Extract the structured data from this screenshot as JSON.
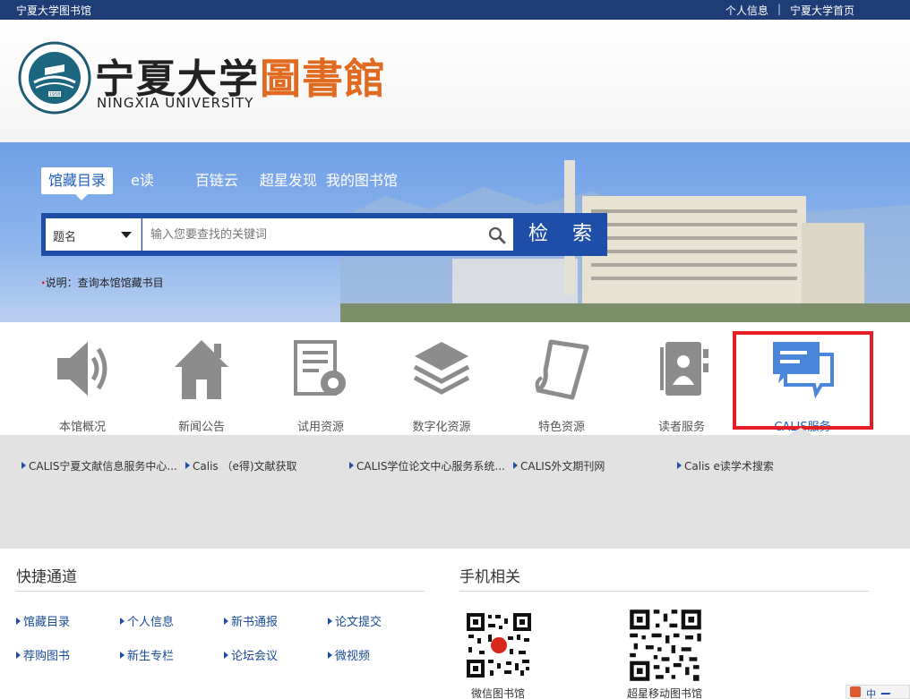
{
  "topbar": {
    "site_name": "宁夏大学图书馆",
    "links": [
      "个人信息",
      "宁夏大学首页"
    ],
    "separator": "|"
  },
  "header": {
    "logo_cn": "宁夏大学",
    "logo_library": "圖書館",
    "logo_en": "NINGXIA UNIVERSITY",
    "seal_year": "1958"
  },
  "search": {
    "tabs": [
      "馆藏目录",
      "e读",
      "百链云",
      "超星发现",
      "我的图书馆"
    ],
    "active_tab": "馆藏目录",
    "field_selected": "题名",
    "placeholder": "输入您要查找的关键词",
    "button_label": "检 索",
    "note": "说明：查询本馆馆藏书目"
  },
  "nav": {
    "items": [
      {
        "label": "本馆概况",
        "icon": "speaker-icon"
      },
      {
        "label": "新闻公告",
        "icon": "home-icon"
      },
      {
        "label": "试用资源",
        "icon": "document-gear-icon"
      },
      {
        "label": "数字化资源",
        "icon": "layers-icon"
      },
      {
        "label": "特色资源",
        "icon": "scroll-icon"
      },
      {
        "label": "读者服务",
        "icon": "contact-book-icon"
      },
      {
        "label": "CALIS服务",
        "icon": "chat-bubbles-icon"
      }
    ],
    "selected": "CALIS服务"
  },
  "calis_links": [
    "CALIS宁夏文献信息服务中心...",
    "Calis （e得)文献获取",
    "CALIS学位论文中心服务系统...",
    "CALIS外文期刊网",
    "Calis e读学术搜索"
  ],
  "quick_access": {
    "title": "快捷通道",
    "links": [
      "馆藏目录",
      "个人信息",
      "新书通报",
      "论文提交",
      "荐购图书",
      "新生专栏",
      "论坛会议",
      "微视频"
    ]
  },
  "mobile": {
    "title": "手机相关",
    "qr_labels": [
      "微信图书馆",
      "超星移动图书馆"
    ]
  },
  "corner": {
    "label": "中"
  },
  "colors": {
    "topbar": "#1e3d77",
    "banner": "#6f9fe6",
    "search_frame": "#1f4ea8",
    "accent_orange": "#e06a1f",
    "highlight_red": "#e51e25",
    "selected_icon": "#4a86d9",
    "icon_gray": "#8c8c8c"
  }
}
